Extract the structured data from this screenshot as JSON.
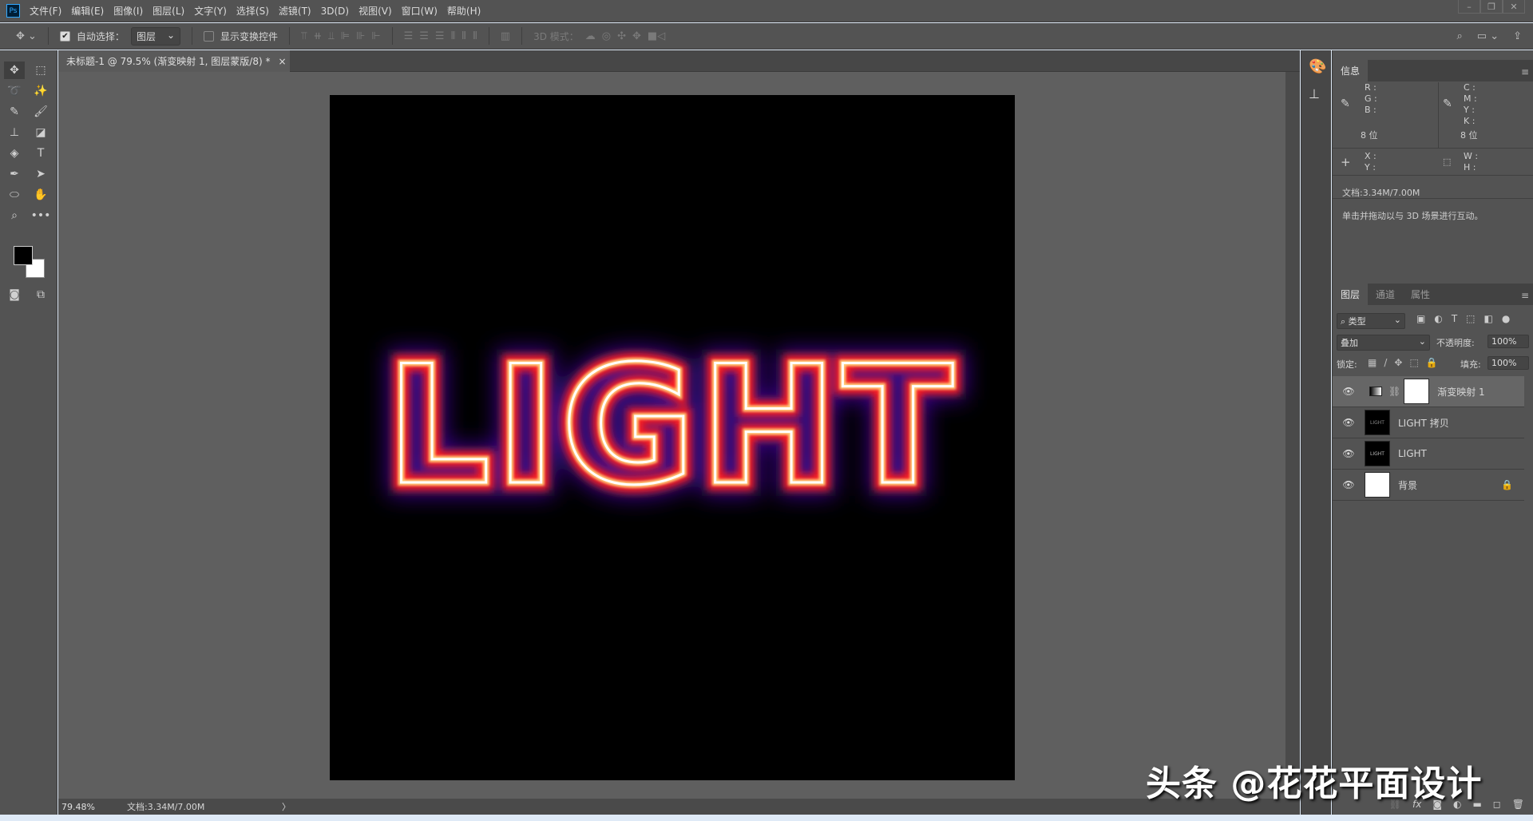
{
  "menubar": {
    "logo": "Ps",
    "items": [
      "文件(F)",
      "编辑(E)",
      "图像(I)",
      "图层(L)",
      "文字(Y)",
      "选择(S)",
      "滤镜(T)",
      "3D(D)",
      "视图(V)",
      "窗口(W)",
      "帮助(H)"
    ],
    "window": {
      "minimize": "–",
      "restore": "❐",
      "close": "✕"
    }
  },
  "options": {
    "auto_select_label": "自动选择：",
    "auto_select_value": "图层",
    "show_transform_label": "显示变换控件",
    "mode_3d_label": "3D 模式："
  },
  "tab": {
    "title": "未标题-1 @ 79.5% (渐变映射 1, 图层蒙版/8) *",
    "close": "×"
  },
  "canvas": {
    "text": "LIGHT"
  },
  "status": {
    "zoom": "79.48%",
    "doc": "文档:3.34M/7.00M",
    "arrow": "〉"
  },
  "info": {
    "tab": "信息",
    "rgb": [
      "R :",
      "G :",
      "B :"
    ],
    "cmyk": [
      "C :",
      "M :",
      "Y :",
      "K :"
    ],
    "bits_left": "8 位",
    "bits_right": "8 位",
    "xy": [
      "X :",
      "Y :"
    ],
    "wh": [
      "W :",
      "H :"
    ],
    "doc": "文档:3.34M/7.00M",
    "hint": "单击并拖动以与 3D 场景进行互动。"
  },
  "layers": {
    "tabs": [
      "图层",
      "通道",
      "属性"
    ],
    "filter": "类型",
    "blend": "叠加",
    "opacity_label": "不透明度:",
    "opacity": "100%",
    "lock_label": "锁定:",
    "fill_label": "填充:",
    "fill": "100%",
    "items": [
      {
        "name": "渐变映射 1"
      },
      {
        "name": "LIGHT 拷贝",
        "thumb": "LIGHT"
      },
      {
        "name": "LIGHT",
        "thumb": "LIGHT"
      },
      {
        "name": "背景"
      }
    ]
  },
  "watermark": "头条 @花花平面设计"
}
